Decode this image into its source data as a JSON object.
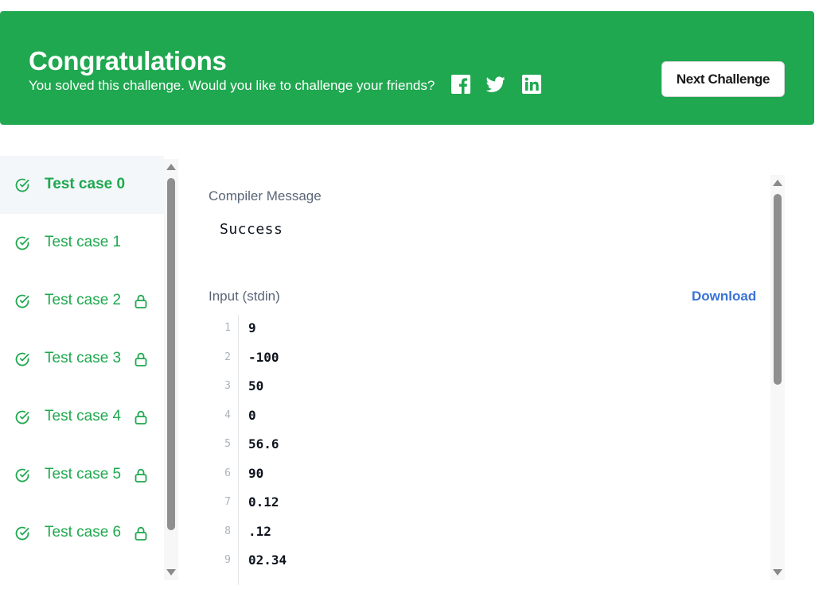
{
  "banner": {
    "title": "Congratulations",
    "subtitle": "You solved this challenge. Would you like to challenge your friends?",
    "social": [
      "facebook-icon",
      "twitter-icon",
      "linkedin-icon"
    ],
    "next_button": "Next Challenge",
    "color": "#1fa84f"
  },
  "test_cases": [
    {
      "label": "Test case 0",
      "locked": false,
      "active": true
    },
    {
      "label": "Test case 1",
      "locked": false,
      "active": false
    },
    {
      "label": "Test case 2",
      "locked": true,
      "active": false
    },
    {
      "label": "Test case 3",
      "locked": true,
      "active": false
    },
    {
      "label": "Test case 4",
      "locked": true,
      "active": false
    },
    {
      "label": "Test case 5",
      "locked": true,
      "active": false
    },
    {
      "label": "Test case 6",
      "locked": true,
      "active": false
    }
  ],
  "result": {
    "compiler_label": "Compiler Message",
    "compiler_message": "Success",
    "input_label": "Input (stdin)",
    "download_label": "Download",
    "input_lines": [
      {
        "no": "1",
        "text": "9"
      },
      {
        "no": "2",
        "text": "-100"
      },
      {
        "no": "3",
        "text": "50"
      },
      {
        "no": "4",
        "text": "0"
      },
      {
        "no": "5",
        "text": "56.6"
      },
      {
        "no": "6",
        "text": "90"
      },
      {
        "no": "7",
        "text": "0.12"
      },
      {
        "no": "8",
        "text": ".12"
      },
      {
        "no": "9",
        "text": "02.34"
      }
    ]
  },
  "colors": {
    "success_green": "#1fa84f",
    "link_blue": "#3a73d6",
    "muted_text": "#5a6677"
  }
}
